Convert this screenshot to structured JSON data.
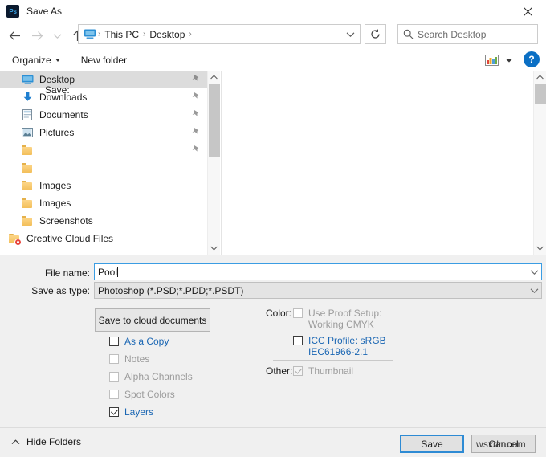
{
  "window": {
    "title": "Save As",
    "app_icon": "photoshop-icon",
    "app_icon_text": "Ps",
    "close_icon": "close-icon"
  },
  "nav": {
    "back_icon": "arrow-left-icon",
    "forward_icon": "arrow-right-icon",
    "recent_icon": "chevron-down-icon",
    "up_icon": "arrow-up-icon",
    "refresh_icon": "refresh-icon",
    "address": {
      "pc_icon": "this-pc-icon",
      "crumbs": [
        "This PC",
        "Desktop"
      ],
      "separator": "›",
      "dropdown_icon": "chevron-down-icon"
    },
    "search": {
      "icon": "search-icon",
      "placeholder": "Search Desktop",
      "value": ""
    }
  },
  "commandbar": {
    "organize_label": "Organize",
    "new_folder_label": "New folder",
    "view_icon": "view-mode-icon",
    "view_caret_icon": "chevron-down-icon",
    "help_icon": "help-icon",
    "help_label": "?"
  },
  "navpane": {
    "items": [
      {
        "label": "Desktop",
        "icon": "desktop-icon",
        "selected": true,
        "pinned": true,
        "indent": "child"
      },
      {
        "label": "Downloads",
        "icon": "downloads-icon",
        "selected": false,
        "pinned": true,
        "indent": "child"
      },
      {
        "label": "Documents",
        "icon": "documents-icon",
        "selected": false,
        "pinned": true,
        "indent": "child"
      },
      {
        "label": "Pictures",
        "icon": "pictures-icon",
        "selected": false,
        "pinned": true,
        "indent": "child"
      },
      {
        "label": "",
        "icon": "folder-icon",
        "selected": false,
        "pinned": true,
        "indent": "child"
      },
      {
        "label": "",
        "icon": "folder-icon",
        "selected": false,
        "pinned": false,
        "indent": "child"
      },
      {
        "label": "Images",
        "icon": "folder-icon",
        "selected": false,
        "pinned": false,
        "indent": "child"
      },
      {
        "label": "Images",
        "icon": "folder-icon",
        "selected": false,
        "pinned": false,
        "indent": "child"
      },
      {
        "label": "Screenshots",
        "icon": "folder-icon",
        "selected": false,
        "pinned": false,
        "indent": "child"
      },
      {
        "label": "Creative Cloud Files",
        "icon": "creative-cloud-folder-icon",
        "selected": false,
        "pinned": false,
        "indent": "root"
      }
    ],
    "scrollbar": {
      "up_icon": "chevron-up-icon",
      "down_icon": "chevron-down-icon"
    }
  },
  "filelist": {
    "items": [],
    "scrollbar": {
      "up_icon": "chevron-up-icon",
      "down_icon": "chevron-down-icon"
    }
  },
  "form": {
    "filename": {
      "label": "File name:",
      "value": "Pool",
      "dropdown_icon": "chevron-down-icon"
    },
    "savetype": {
      "label": "Save as type:",
      "value": "Photoshop (*.PSD;*.PDD;*.PSDT)",
      "dropdown_icon": "chevron-down-icon"
    },
    "cloud_button_label": "Save to cloud documents",
    "save_group_label": "Save:",
    "save_options": [
      {
        "label": "As a Copy",
        "checked": false,
        "enabled": true
      },
      {
        "label": "Notes",
        "checked": false,
        "enabled": false
      },
      {
        "label": "Alpha Channels",
        "checked": false,
        "enabled": false
      },
      {
        "label": "Spot Colors",
        "checked": false,
        "enabled": false
      },
      {
        "label": "Layers",
        "checked": true,
        "enabled": true
      }
    ],
    "color_group_label": "Color:",
    "color_options": [
      {
        "label": "Use Proof Setup:",
        "sublabel": "Working CMYK",
        "checked": false,
        "enabled": false
      },
      {
        "label": "ICC Profile:  sRGB",
        "sublabel": "IEC61966-2.1",
        "checked": false,
        "enabled": true
      }
    ],
    "other_group_label": "Other:",
    "other_options": [
      {
        "label": "Thumbnail",
        "checked": true,
        "enabled": false
      }
    ]
  },
  "footer": {
    "hide_folders_label": "Hide Folders",
    "hide_folders_icon": "chevron-up-icon",
    "save_label": "Save",
    "cancel_label": "Cancel"
  },
  "watermark": {
    "text": "wsxdn.com"
  },
  "colors": {
    "accent": "#2e8bd4",
    "link": "#1a66b3",
    "panel": "#f0f0f0",
    "selection": "#dcdcdc",
    "help": "#0b6fc4"
  }
}
